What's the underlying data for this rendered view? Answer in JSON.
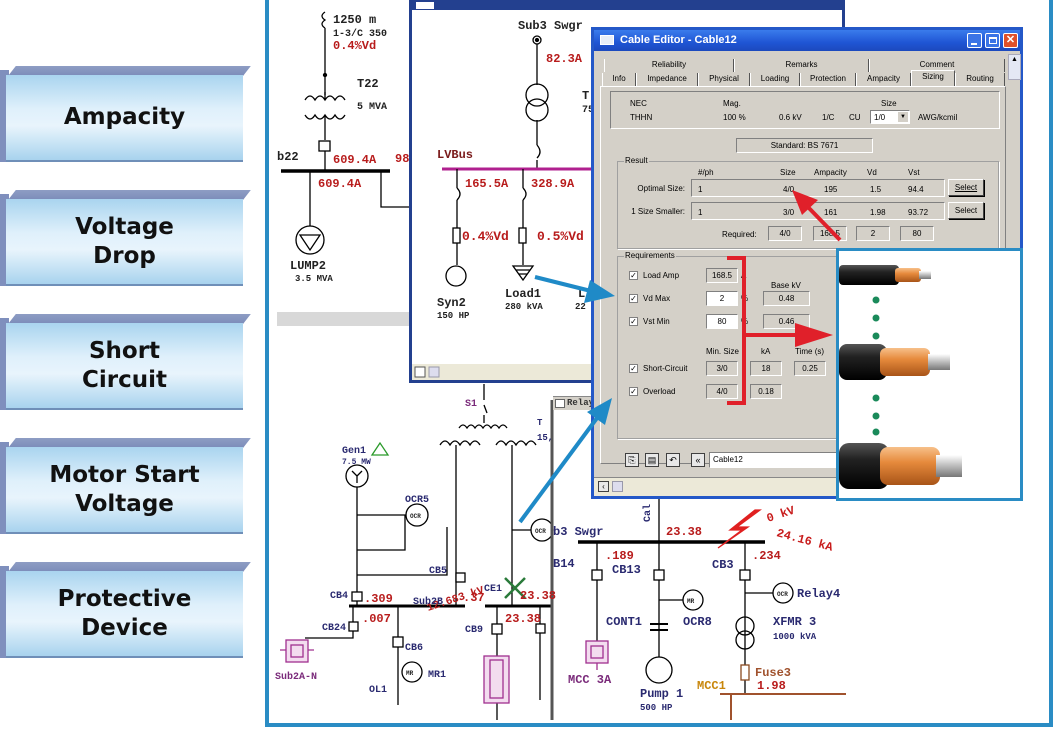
{
  "features": [
    {
      "label": "Ampacity"
    },
    {
      "label": "Voltage\nDrop"
    },
    {
      "label": "Short\nCircuit"
    },
    {
      "label": "Motor Start\nVoltage"
    },
    {
      "label": "Protective\nDevice"
    }
  ],
  "diagram": {
    "cable_len": "1250 m",
    "cable_type": "1-3/C 350",
    "cable_vd": "0.4%Vd",
    "t22": "T22",
    "t22_rating": "5 MVA",
    "b22": "b22",
    "b22_in": "609.4A",
    "b22_right": "98",
    "b22_out": "609.4A",
    "lump2": "LUMP2",
    "lump2_rating": "3.5 MVA",
    "s1": "S1",
    "t_label": "T",
    "t_rating": "15,",
    "gen1": "Gen1",
    "gen1_rating": "7.5 MW",
    "ocr5": "OCR5",
    "ocr": "OCR",
    "cb5": "CB5",
    "sub2b_kv": "12.683 kV",
    "cb4": "CB4",
    "cb4_flow": ".309",
    "sub2b": "Sub2B",
    "sub2b_flow": ".37",
    "cb24_flow": ".007",
    "cb24": "CB24",
    "sub2a": "Sub2A-N",
    "cb6": "CB6",
    "mr": "MR",
    "mr1": "MR1",
    "ol1": "OL1",
    "ce1": "CE1",
    "flow_a": "23.38",
    "flow_b": "23.38",
    "cb9": "CB9",
    "relay_win": "Relay",
    "b3": "b3 Swgr",
    "cal": "Cal",
    "b3_flow": "23.38",
    "fault_kv": "0 kV",
    "fault_ka": "24.16 kA",
    "b14": "B14",
    "flow_189": ".189",
    "cb13": "CB13",
    "cb3": "CB3",
    "flow_234": ".234",
    "relay4": "Relay4",
    "ocr8": "OCR8",
    "cont1": "CONT1",
    "xfmr3": "XFMR 3",
    "xfmr3_rating": "1000 kVA",
    "mcc3a": "MCC 3A",
    "pump1": "Pump 1",
    "pump1_rating": "500 HP",
    "fuse3": "Fuse3",
    "mcc1": "MCC1",
    "mcc1_flow": "1.98"
  },
  "lv_window": {
    "sub3": "Sub3 Swgr",
    "sub3_flow": "82.3A",
    "t_label": "T",
    "t_rating": "75",
    "lvbus": "LVBus",
    "flow1": "165.5A",
    "flow2": "328.9A",
    "vd1": "0.4%Vd",
    "vd2": "0.5%Vd",
    "syn2": "Syn2",
    "syn2_rating": "150 HP",
    "load1": "Load1",
    "load1_rating": "280 kVA",
    "partial_label": "L",
    "partial_rating": "22"
  },
  "cable_editor": {
    "title": "Cable Editor - Cable12",
    "tabs_row1": [
      "Reliability",
      "Remarks",
      "Comment"
    ],
    "tabs_row2": [
      "Info",
      "Impedance",
      "Physical",
      "Loading",
      "Protection",
      "Ampacity",
      "Sizing",
      "Routing"
    ],
    "active_tab": "Sizing",
    "cable": {
      "code": "NEC",
      "insulation": "THHN",
      "mag_label": "Mag.",
      "mag": "100 %",
      "kv": "0.6 kV",
      "conductors": "1/C",
      "material": "CU",
      "size_label": "Size",
      "size": "1/0",
      "size_unit": "AWG/kcmil"
    },
    "standard": "Standard: BS 7671",
    "result": {
      "label": "Result",
      "headers": [
        "#/ph",
        "Size",
        "Ampacity",
        "Vd",
        "Vst"
      ],
      "rows": [
        {
          "label": "Optimal Size:",
          "values": [
            "1",
            "4/0",
            "195",
            "1.5",
            "94.4"
          ],
          "button": "Select"
        },
        {
          "label": "1 Size Smaller:",
          "values": [
            "1",
            "3/0",
            "161",
            "1.98",
            "93.72"
          ],
          "button": "Select"
        }
      ],
      "required_label": "Required:",
      "required": [
        "4/0",
        "168.5",
        "2",
        "80"
      ]
    },
    "requirements": {
      "label": "Requirements",
      "load_amp": {
        "label": "Load Amp",
        "value": "168.5",
        "unit": "A",
        "checked": true
      },
      "base_kv_label": "Base kV",
      "vd_max": {
        "label": "Vd Max",
        "value": "2",
        "unit": "%",
        "base_kv": "0.48",
        "checked": true
      },
      "vst_min": {
        "label": "Vst Min",
        "value": "80",
        "unit": "%",
        "base_kv": "0.46",
        "checked": true
      },
      "headers": [
        "Min. Size",
        "kA",
        "Time (s)"
      ],
      "short_circuit": {
        "label": "Short-Circuit",
        "min_size": "3/0",
        "ka": "18",
        "time": "0.25",
        "checked": true
      },
      "overload": {
        "label": "Overload",
        "min_size": "4/0",
        "ka": "0.18",
        "checked": true
      }
    },
    "id_field": "Cable12"
  },
  "colors": {
    "frame": "#2a8cc4",
    "annot_red": "#e0202a",
    "annot_blue": "#1f8ac7",
    "bus_magenta": "#b0208f",
    "value_red": "#b81c1c",
    "label_navy": "#2a2a70"
  }
}
